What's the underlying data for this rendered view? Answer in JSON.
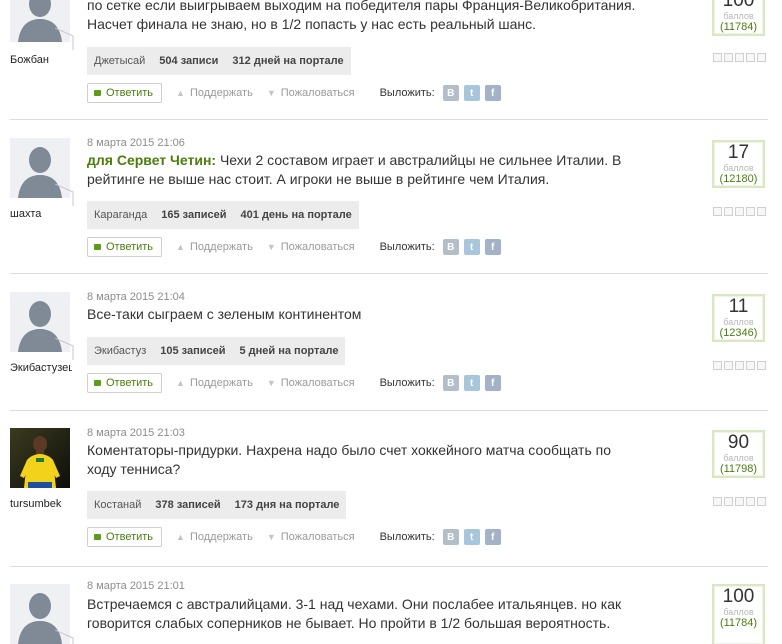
{
  "comments": [
    {
      "date": "",
      "user": "Божбан",
      "avatar": "default",
      "mention": "",
      "text_lines": [
        "по сетке если выигрываем выходим на победителя пары Франция-Великобритания.",
        "Насчет финала не знаю, но в 1/2 попасть у нас есть реальный шанс."
      ],
      "city": "Джетысай",
      "posts": "504 записи",
      "days": "312 дней на портале",
      "score": "100",
      "score_label": "баллов",
      "rank": "(11784)"
    },
    {
      "date": "8 марта 2015 21:06",
      "user": "шахта",
      "avatar": "default",
      "mention": "для Сервет Четин:",
      "text_lines": [
        "Чехи 2 составом играет и австралийцы не сильнее Италии. В",
        "рейтинге не выше нас стоит. А игроки не выше в рейтинге чем Италия."
      ],
      "city": "Караганда",
      "posts": "165 записей",
      "days": "401 день на портале",
      "score": "17",
      "score_label": "баллов",
      "rank": "(12180)"
    },
    {
      "date": "8 марта 2015 21:04",
      "user": "Экибастузец",
      "avatar": "default",
      "mention": "",
      "text_lines": [
        "Все-таки сыграем с зеленым континентом"
      ],
      "city": "Экибастуз",
      "posts": "105 записей",
      "days": "5 дней на портале",
      "score": "11",
      "score_label": "баллов",
      "rank": "(12346)"
    },
    {
      "date": "8 марта 2015 21:03",
      "user": "tursumbek",
      "avatar": "photo",
      "mention": "",
      "text_lines": [
        "Коментаторы-придурки. Нахрена надо было счет хоккейного матча сообщать по",
        "ходу тенниса?"
      ],
      "city": "Костанай",
      "posts": "378 записей",
      "days": "173 дня на портале",
      "score": "90",
      "score_label": "баллов",
      "rank": "(11798)"
    },
    {
      "date": "8 марта 2015 21:01",
      "user": "",
      "avatar": "default",
      "mention": "",
      "text_lines": [
        "Встречаемся с австралийцами. 3-1 над чехами. Они послабее итальянцев. но как",
        "говорится слабых соперников не бывает. Но пройти в 1/2 большая вероятность."
      ],
      "city": "",
      "posts": "",
      "days": "",
      "score": "100",
      "score_label": "баллов",
      "rank": "(11784)"
    }
  ],
  "actions": {
    "reply": "Ответить",
    "support": "Поддержать",
    "complain": "Пожаловаться",
    "share": "Выложить:"
  },
  "social": {
    "vk": "В",
    "twitter": "t",
    "facebook": "f"
  },
  "colors": {
    "accent_green": "#4a7d0c",
    "infobar_bg": "#ececec",
    "score_border": "#d9e7c2"
  }
}
